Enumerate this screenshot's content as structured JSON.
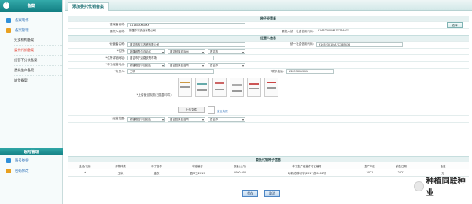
{
  "sidebar": {
    "header": "备案",
    "items": [
      {
        "label": "备案制作",
        "color": "#2f8fd8"
      },
      {
        "label": "备案管理",
        "color": "#e8a020"
      }
    ],
    "subitems": [
      "分支机构备案",
      "委托代销备案",
      "经营不分装备案",
      "委托生产备案",
      "缺货备案"
    ],
    "active_sub": 1,
    "bottom_header": "账号管理",
    "bottom_items": [
      {
        "label": "账号维护",
        "color": "#2f8fd8"
      },
      {
        "label": "密码修改",
        "color": "#e8a020"
      }
    ]
  },
  "tab": {
    "title": "添加委托代销备案"
  },
  "form": {
    "section1": "种子经营者",
    "name_label": "*备案者名称:",
    "name_value": "A1180XXXXXX",
    "select_button": "选择",
    "entrust_label": "委托人名称:",
    "entrust_value": "新疆中农农业有限公司",
    "credit_label": "委托人统一社会信用代码:",
    "credit_value": "91652301MA7777A07E",
    "section2": "经营人信息",
    "person_label": "*经营者名称:",
    "person_value": "昌吉市农丰农资有限公司",
    "person_credit_label": "统一社会信用代码:",
    "person_credit_value": "91652301MA7C38B436",
    "address_label": "*住所:",
    "address_selects": [
      "新疆维吾尔自治区",
      "昌吉回族自治州",
      "昌吉市"
    ],
    "detail_label": "*住所详细地址:",
    "detail_value": "昌吉市宁边路农资市场",
    "biz_label": "*种子经营地点:",
    "biz_selects": [
      "新疆维吾尔自治区",
      "昌吉回族自治州",
      "昌吉市"
    ],
    "legal_label": "*负责人:",
    "legal_value": "王明",
    "phone_label": "*联系电话:",
    "phone_value": "13899XXXXXX",
    "upload_label": "*上传营业执照(扫描复印件):",
    "upload_button": "上传文件",
    "upload_filename": "营业执照",
    "region_label": "*经营范围:",
    "region_selects": [
      "新疆维吾尔自治区",
      "昌吉回族自治州",
      "昌吉市"
    ],
    "section3": "委托代销种子信息"
  },
  "table": {
    "columns": [
      "全选/代销",
      "作物种类",
      "种子名称",
      "审定编号",
      "数量(公斤)",
      "种子生产经营许可证编号",
      "生产年度",
      "销售日期",
      "备注"
    ],
    "rows": [
      [
        "✔",
        "玉米",
        "金农",
        "昌审玉2019",
        "5000.000",
        "B(新)农种许字(2017)第0008号",
        "2021",
        "2021",
        "无"
      ]
    ]
  },
  "actions": {
    "save": "保存",
    "cancel": "取消"
  },
  "watermark": "种植同联种业"
}
